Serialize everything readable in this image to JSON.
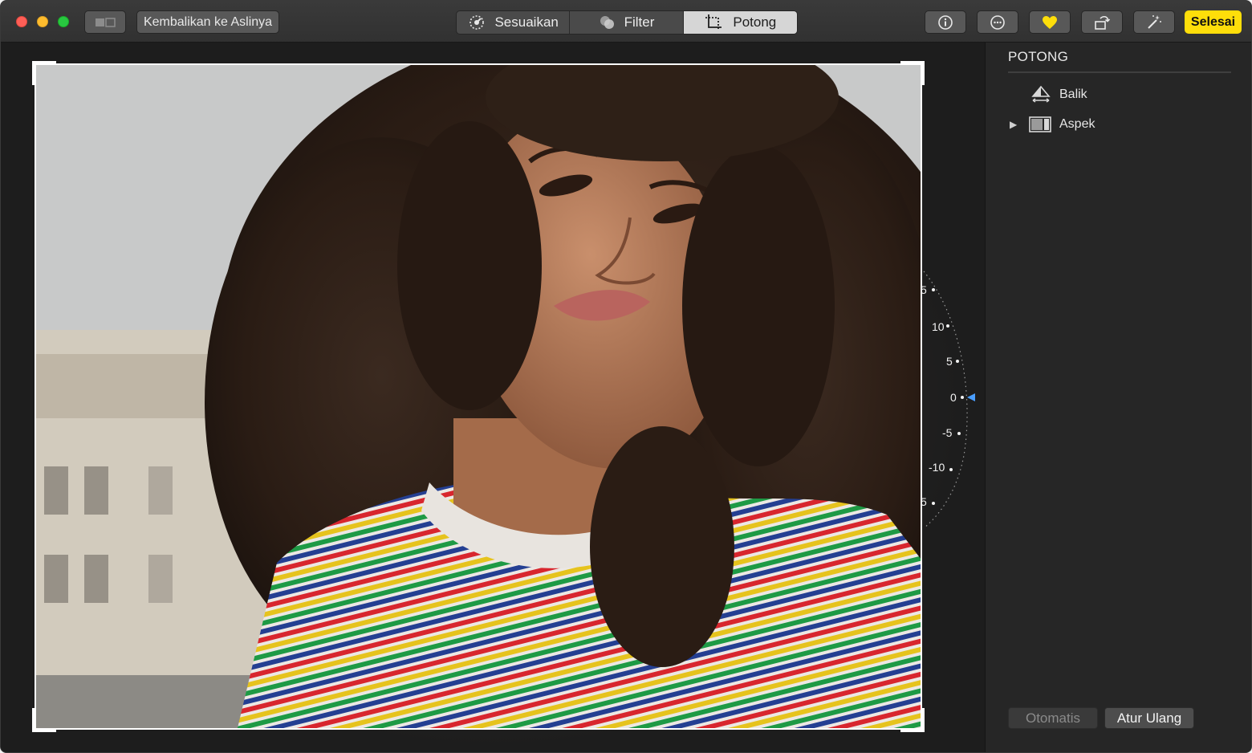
{
  "toolbar": {
    "revert_label": "Kembalikan ke Aslinya",
    "tabs": [
      {
        "label": "Sesuaikan",
        "icon": "adjust-dial-icon"
      },
      {
        "label": "Filter",
        "icon": "filter-circles-icon"
      },
      {
        "label": "Potong",
        "icon": "crop-icon",
        "selected": true
      }
    ],
    "info_icon": "info-icon",
    "more_icon": "ellipsis-icon",
    "favorite_icon": "heart-icon",
    "rotate_icon": "rotate-icon",
    "enhance_icon": "magic-wand-icon",
    "done_label": "Selesai",
    "done_color": "#fede0a"
  },
  "canvas": {
    "straighten_dial": {
      "labels": [
        "5",
        "10",
        "5",
        "0",
        "-5",
        "-10",
        "5"
      ],
      "current_value": "0",
      "indicator_color": "#4a9eff"
    }
  },
  "sidebar": {
    "title": "POTONG",
    "items": [
      {
        "label": "Balik",
        "icon": "flip-icon"
      },
      {
        "label": "Aspek",
        "icon": "aspect-ratio-icon"
      }
    ],
    "auto_label": "Otomatis",
    "reset_label": "Atur Ulang"
  }
}
